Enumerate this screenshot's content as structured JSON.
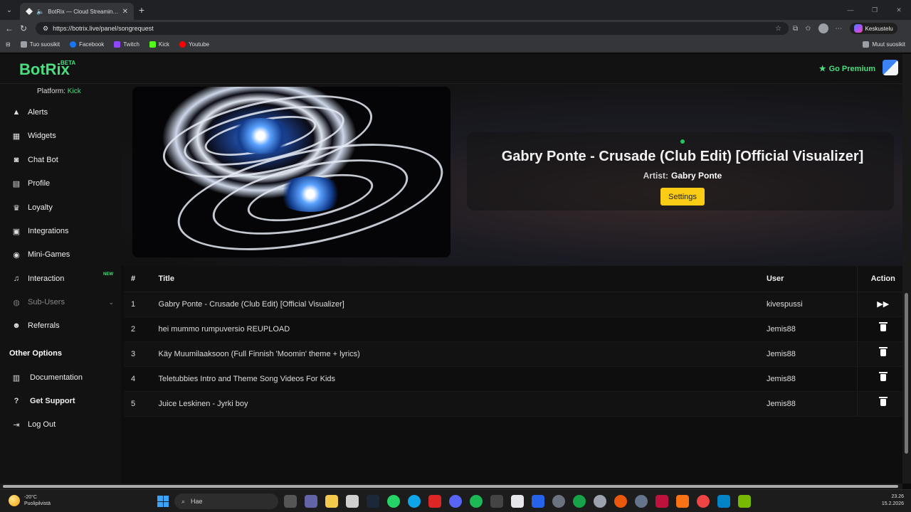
{
  "browser": {
    "tab_title": "BotRix — Cloud Streaming Bo",
    "url": "https://botrix.live/panel/songrequest",
    "copilot_label": "Keskustelu",
    "bookmarks": [
      {
        "label": "Tuo suosikit",
        "color": "#9aa0a6"
      },
      {
        "label": "Facebook",
        "color": "#1877f2"
      },
      {
        "label": "Twitch",
        "color": "#9146ff"
      },
      {
        "label": "Kick",
        "color": "#53fc18"
      },
      {
        "label": "Youtube",
        "color": "#ff0000"
      }
    ],
    "other_bookmarks": "Muut suosikit"
  },
  "app": {
    "logo": "BotRix",
    "beta": "BETA",
    "premium": "Go Premium",
    "accent": "#4ade80"
  },
  "sidebar": {
    "platform_label": "Platform:",
    "platform_value": "Kick",
    "items": [
      {
        "label": "Alerts",
        "icon": "warning-icon"
      },
      {
        "label": "Widgets",
        "icon": "grid-icon"
      },
      {
        "label": "Chat Bot",
        "icon": "robot-icon"
      },
      {
        "label": "Profile",
        "icon": "id-card-icon"
      },
      {
        "label": "Loyalty",
        "icon": "trophy-icon"
      },
      {
        "label": "Integrations",
        "icon": "plug-icon"
      },
      {
        "label": "Mini-Games",
        "icon": "gamepad-icon"
      },
      {
        "label": "Interaction",
        "icon": "music-icon",
        "badge": "NEW"
      },
      {
        "label": "Sub-Users",
        "icon": "users-icon"
      },
      {
        "label": "Referrals",
        "icon": "people-icon"
      }
    ],
    "other_header": "Other Options",
    "other_items": [
      {
        "label": "Documentation",
        "icon": "book-icon"
      },
      {
        "label": "Get Support",
        "icon": "question-icon"
      },
      {
        "label": "Log Out",
        "icon": "logout-icon"
      }
    ]
  },
  "now_playing": {
    "title": "Gabry Ponte - Crusade (Club Edit) [Official Visualizer]",
    "artist_label": "Artist:",
    "artist": "Gabry Ponte",
    "settings_label": "Settings",
    "button_color": "#facc15"
  },
  "queue": {
    "headers": {
      "num": "#",
      "title": "Title",
      "user": "User",
      "action": "Action"
    },
    "rows": [
      {
        "num": "1",
        "title": "Gabry Ponte - Crusade (Club Edit) [Official Visualizer]",
        "user": "kivespussi",
        "action": "skip-icon"
      },
      {
        "num": "2",
        "title": "hei mummo rumpuversio REUPLOAD",
        "user": "Jemis88",
        "action": "trash-icon"
      },
      {
        "num": "3",
        "title": "Käy Muumilaaksoon (Full Finnish 'Moomin' theme + lyrics)",
        "user": "Jemis88",
        "action": "trash-icon"
      },
      {
        "num": "4",
        "title": "Teletubbies Intro and Theme Song Videos For Kids",
        "user": "Jemis88",
        "action": "trash-icon"
      },
      {
        "num": "5",
        "title": "Juice Leskinen - Jyrki boy",
        "user": "Jemis88",
        "action": "trash-icon"
      }
    ]
  },
  "taskbar": {
    "temperature": "-20°C",
    "weather": "Puolipilvistä",
    "search_placeholder": "Hae",
    "time": "23.26",
    "date": "15.2.2026"
  }
}
